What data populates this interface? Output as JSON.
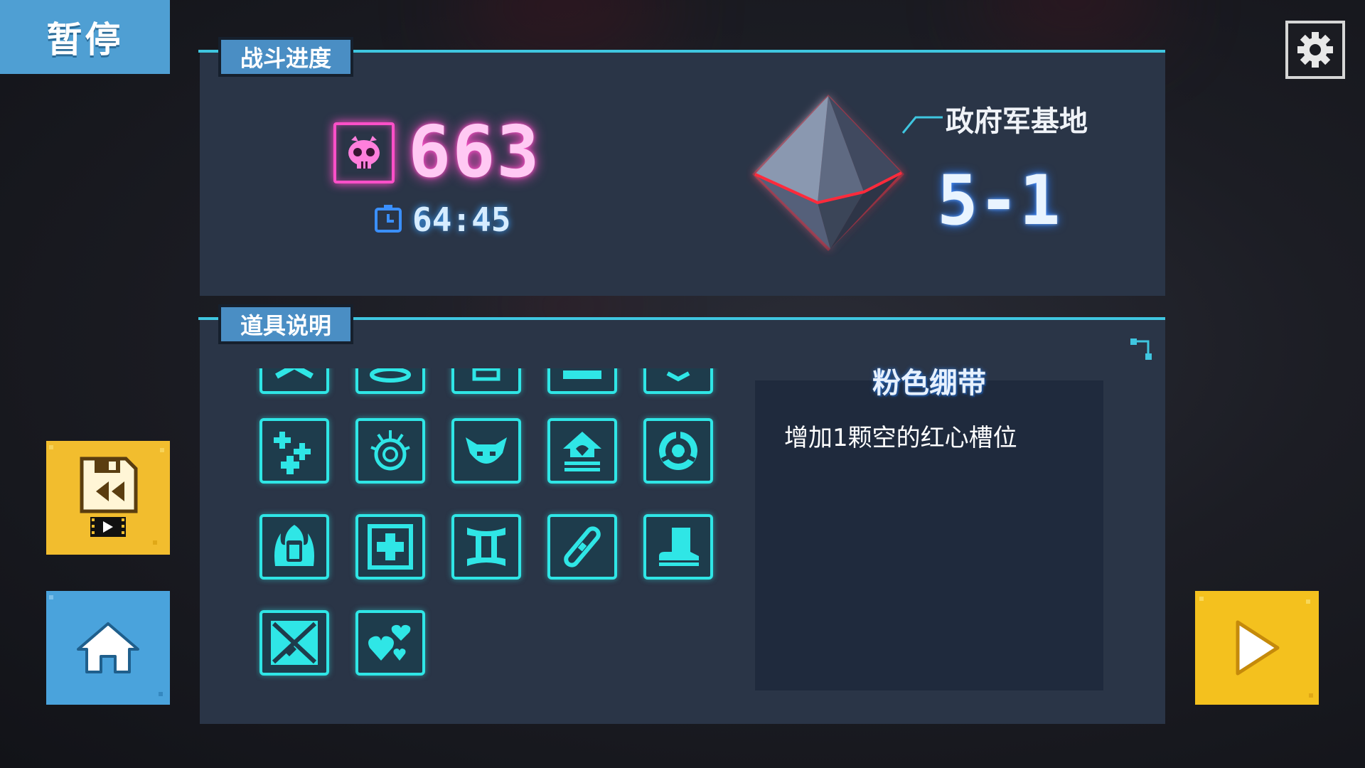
{
  "header": {
    "pause_label": "暂停"
  },
  "battle_progress": {
    "tab_label": "战斗进度",
    "kill_count": "663",
    "time": "64:45",
    "location_name": "政府军基地",
    "stage": "5-1"
  },
  "items_panel": {
    "tab_label": "道具说明",
    "items": [
      {
        "icon": "partial-item-1-icon"
      },
      {
        "icon": "partial-item-2-icon"
      },
      {
        "icon": "partial-item-3-icon"
      },
      {
        "icon": "partial-item-4-icon"
      },
      {
        "icon": "partial-item-5-icon"
      },
      {
        "icon": "plus-cluster-icon"
      },
      {
        "icon": "spiked-target-icon"
      },
      {
        "icon": "horned-mask-icon"
      },
      {
        "icon": "house-shield-icon"
      },
      {
        "icon": "ring-target-icon"
      },
      {
        "icon": "flaming-jar-icon"
      },
      {
        "icon": "medkit-cross-icon"
      },
      {
        "icon": "gemini-pillar-icon"
      },
      {
        "icon": "pink-bandage-icon"
      },
      {
        "icon": "boot-icon"
      },
      {
        "icon": "crossed-blades-icon"
      },
      {
        "icon": "hearts-icon"
      }
    ],
    "selected": {
      "name": "粉色绷带",
      "description": "增加1颗空的红心槽位"
    }
  },
  "colors": {
    "panel_bg": "#2a3547",
    "accent_cyan": "#3fc6e0",
    "item_border": "#2fe6e6",
    "kill_pink": "#ff4fc8",
    "pause_blue": "#4f9fd3",
    "gold": "#f2bd2e"
  },
  "buttons": {
    "replay": "save-replay-icon",
    "home": "home-icon",
    "play": "play-icon",
    "settings": "gear-icon"
  }
}
